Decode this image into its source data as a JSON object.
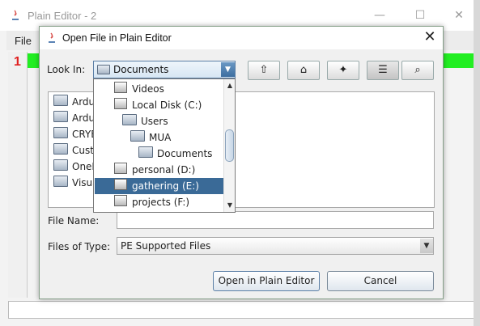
{
  "background": {
    "title": "Plain Editor - 2",
    "menu_file": "File",
    "line_number": "1"
  },
  "dialog": {
    "title": "Open File in Plain Editor",
    "look_in_label": "Look In:",
    "look_in_value": "Documents",
    "file_list": [
      {
        "label": "Ardui"
      },
      {
        "label": "Ardui"
      },
      {
        "label": "CRYE"
      },
      {
        "label": "Custo"
      },
      {
        "label": "OneN"
      },
      {
        "label": "Visua"
      }
    ],
    "file_name_label": "File Name:",
    "file_name_value": "",
    "files_of_type_label": "Files of Type:",
    "files_of_type_value": "PE Supported Files",
    "open_button": "Open in Plain Editor",
    "cancel_button": "Cancel"
  },
  "look_in_popup": {
    "items": [
      {
        "label": "Videos",
        "icon": "drive-icon",
        "depth": 0
      },
      {
        "label": "Local Disk (C:)",
        "icon": "drive-icon",
        "depth": 0
      },
      {
        "label": "Users",
        "icon": "folder-icon",
        "depth": 1
      },
      {
        "label": "MUA",
        "icon": "folder-icon",
        "depth": 2
      },
      {
        "label": "Documents",
        "icon": "folder-icon",
        "depth": 3
      },
      {
        "label": "personal (D:)",
        "icon": "drive-icon",
        "depth": 0
      },
      {
        "label": "gathering (E:)",
        "icon": "drive-icon",
        "depth": 0,
        "selected": true
      },
      {
        "label": "projects (F:)",
        "icon": "drive-icon",
        "depth": 0
      }
    ]
  },
  "colors": {
    "selection": "#3a6a97",
    "highlight_line": "#22ee22",
    "line_number": "#e02020"
  }
}
